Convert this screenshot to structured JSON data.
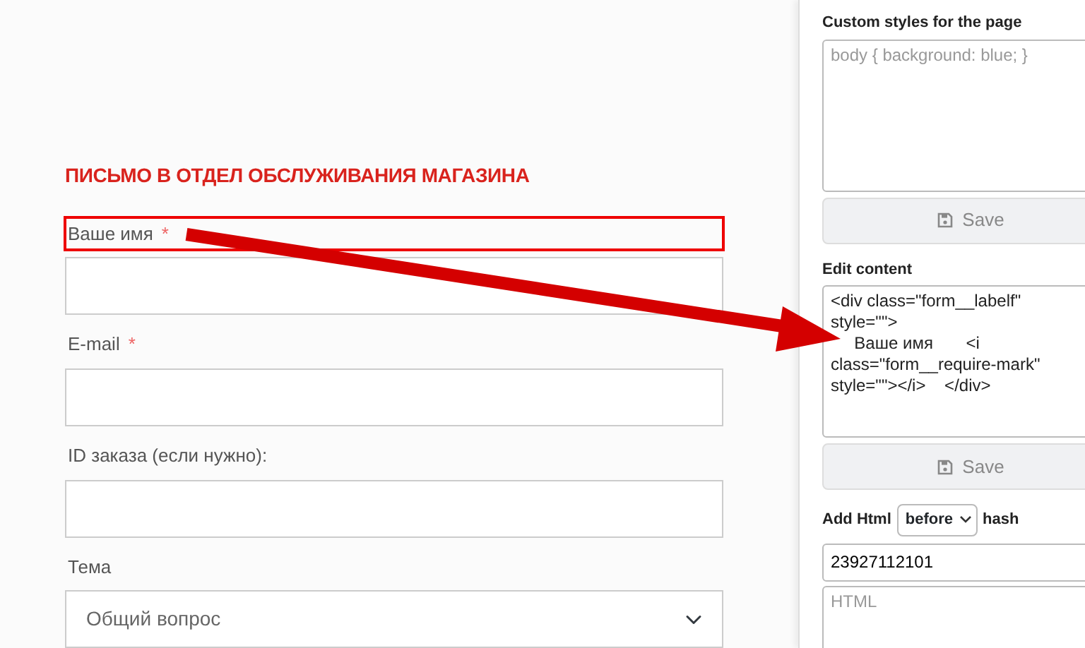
{
  "form": {
    "title": "ПИСЬМО В ОТДЕЛ ОБСЛУЖИВАНИЯ МАГАЗИНА",
    "fields": [
      {
        "kind": "input",
        "label": "Ваше имя",
        "required_mark": "*",
        "highlighted": true
      },
      {
        "kind": "input",
        "label": "E-mail",
        "required_mark": "*",
        "highlighted": false
      },
      {
        "kind": "input",
        "label": "ID заказа (если нужно):",
        "highlighted": false
      },
      {
        "kind": "select",
        "label": "Тема",
        "highlighted": false,
        "value": "Общий вопрос"
      }
    ]
  },
  "annotation": {
    "kind": "arrow"
  },
  "editor": {
    "styles": {
      "label": "Custom styles for the page",
      "placeholder": "body { background: blue; }",
      "button": "Save"
    },
    "content": {
      "label": "Edit content",
      "value": "<div class=\"form__labelf\" style=\"\">\n     Ваше имя       <i class=\"form__require-mark\" style=\"\"></i>    </div>",
      "button": "Save"
    },
    "add_html": {
      "label": "Add Html",
      "position": "before",
      "hash_label": "hash",
      "hash": "23927112101",
      "placeholder": "HTML"
    }
  }
}
